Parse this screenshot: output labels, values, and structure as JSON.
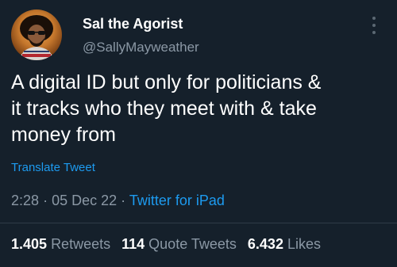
{
  "user": {
    "name": "Sal the Agorist",
    "handle": "@SallyMayweather"
  },
  "tweet": {
    "text": "A digital ID but only for politicians &\nit tracks who they meet with & take\nmoney from",
    "translate_label": "Translate Tweet",
    "time": "2:28",
    "date": "05 Dec 22",
    "source": "Twitter for iPad",
    "separator": "·"
  },
  "stats": {
    "retweets_count": "1.405",
    "retweets_label": "Retweets",
    "quote_count": "114",
    "quote_label": "Quote Tweets",
    "likes_count": "6.432",
    "likes_label": "Likes"
  },
  "colors": {
    "background": "#15202b",
    "accent": "#1d9bf0",
    "secondary_text": "#8b98a5"
  }
}
